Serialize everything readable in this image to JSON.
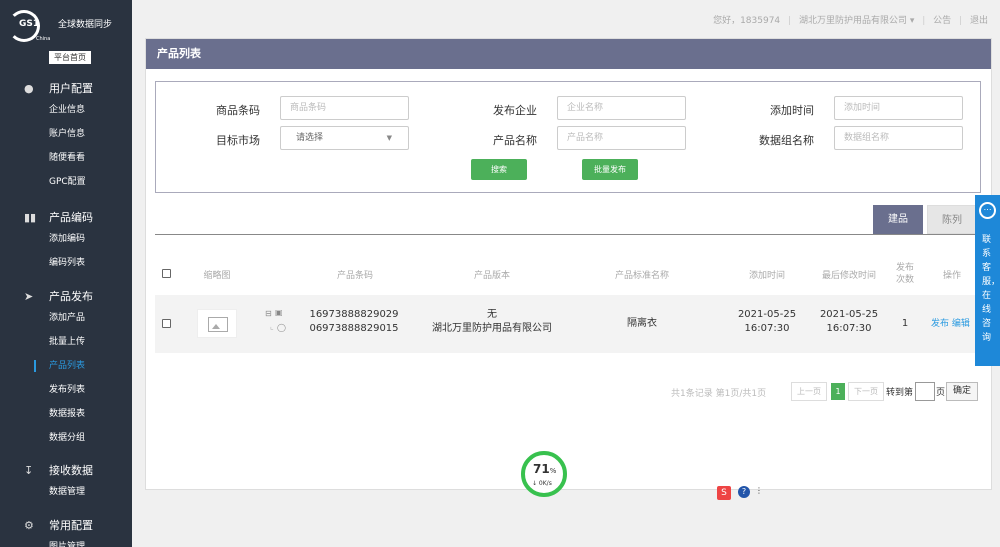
{
  "sidebar": {
    "logo_text": "GS1",
    "logo_sub": "China",
    "title": "全球数据同步",
    "home_button": "平台首页",
    "groups": [
      {
        "label": "用户配置",
        "icon": "user-icon",
        "items": [
          "企业信息",
          "账户信息",
          "随便看看",
          "GPC配置"
        ]
      },
      {
        "label": "产品编码",
        "icon": "barcode-icon",
        "items": [
          "添加编码",
          "编码列表"
        ]
      },
      {
        "label": "产品发布",
        "icon": "send-icon",
        "items": [
          "添加产品",
          "批量上传",
          "产品列表",
          "发布列表",
          "数据报表",
          "数据分组"
        ]
      },
      {
        "label": "接收数据",
        "icon": "download-icon",
        "items": [
          "数据管理"
        ]
      },
      {
        "label": "常用配置",
        "icon": "gear-icon",
        "items": [
          "图片管理"
        ]
      }
    ],
    "active_item": "产品列表"
  },
  "topbar": {
    "greeting": "您好，1835974",
    "company": "湖北万里防护用品有限公司",
    "notice": "公告",
    "logout": "退出"
  },
  "panel": {
    "title": "产品列表"
  },
  "search": {
    "fields": {
      "barcode": {
        "label": "商品条码",
        "placeholder": "商品条码"
      },
      "publisher": {
        "label": "发布企业",
        "placeholder": "企业名称"
      },
      "added_time": {
        "label": "添加时间",
        "placeholder": "添加时间"
      },
      "market": {
        "label": "目标市场",
        "value": "请选择"
      },
      "product_name": {
        "label": "产品名称",
        "placeholder": "产品名称"
      },
      "group_name": {
        "label": "数据组名称",
        "placeholder": "数据组名称"
      }
    },
    "search_button": "搜索",
    "batch_publish_button": "批量发布"
  },
  "tabs": [
    "建品",
    "陈列"
  ],
  "table": {
    "headers": [
      "缩略图",
      "产品条码",
      "产品版本",
      "产品标准名称",
      "添加时间",
      "最后修改时间",
      "发布次数",
      "操作"
    ],
    "rows": [
      {
        "barcode_1": "16973888829029",
        "barcode_2": "06973888829015",
        "version": "无",
        "version_company": "湖北万里防护用品有限公司",
        "standard_name": "隔离衣",
        "added_date": "2021-05-25",
        "added_time": "16:07:30",
        "modified_date": "2021-05-25",
        "modified_time": "16:07:30",
        "publish_count": "1",
        "action_publish": "发布",
        "action_edit": "编辑"
      }
    ]
  },
  "pager": {
    "summary": "共1条记录  第1页/共1页",
    "prev": "上一页",
    "current": "1",
    "next": "下一页",
    "goto_prefix": "转到第",
    "goto_suffix": "页",
    "confirm": "确定"
  },
  "speed_widget": {
    "percent": "71",
    "percent_sign": "%",
    "rate": "↓ 0K/s"
  },
  "service": {
    "text": "联系客服，在线咨询"
  },
  "tray": {
    "s_label": "S",
    "q_label": "?",
    "d_label": "⋮"
  }
}
